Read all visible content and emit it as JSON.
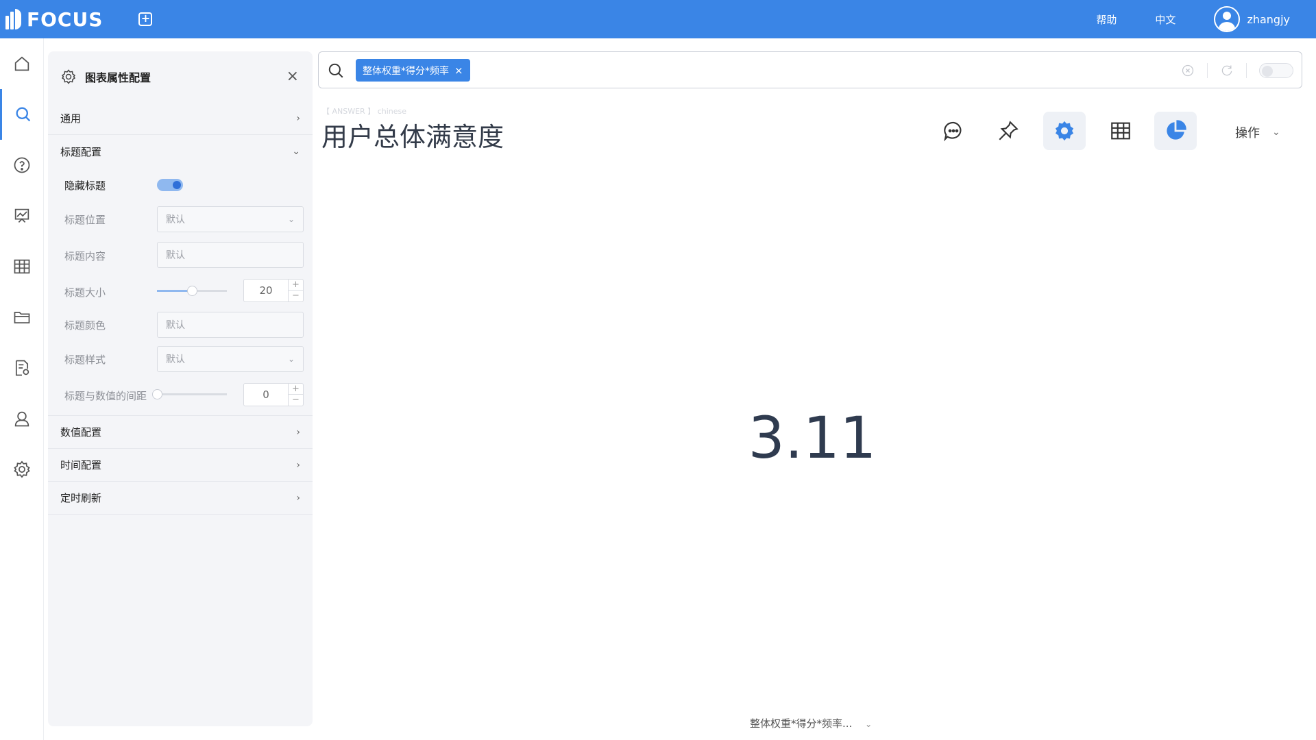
{
  "app": {
    "name": "FOCUS"
  },
  "topbar": {
    "help": "帮助",
    "language": "中文",
    "username": "zhangjy"
  },
  "panel": {
    "title": "图表属性配置",
    "sections": {
      "general": "通用",
      "title_config": "标题配置",
      "value_config": "数值配置",
      "time_config": "时间配置",
      "auto_refresh": "定时刷新"
    },
    "fields": {
      "hide_title": {
        "label": "隐藏标题",
        "on": true
      },
      "title_position": {
        "label": "标题位置",
        "value": "默认"
      },
      "title_content": {
        "label": "标题内容",
        "placeholder": "默认"
      },
      "title_size": {
        "label": "标题大小",
        "value": "20",
        "slider_fraction": 0.5
      },
      "title_color": {
        "label": "标题颜色",
        "value": "默认"
      },
      "title_style": {
        "label": "标题样式",
        "value": "默认"
      },
      "title_value_gap": {
        "label": "标题与数值的间距",
        "value": "0",
        "slider_fraction": 0
      }
    }
  },
  "search": {
    "chip": "整体权重*得分*频率"
  },
  "answer": {
    "tag": "【 ANSWER 】 chinese",
    "title": "用户总体满意度",
    "value": "3.11",
    "operations": "操作",
    "field_selector": "整体权重*得分*频率..."
  },
  "colors": {
    "brand": "#3a85e6",
    "panel_bg": "#f4f5f8",
    "value_text": "#2f3b4f"
  }
}
